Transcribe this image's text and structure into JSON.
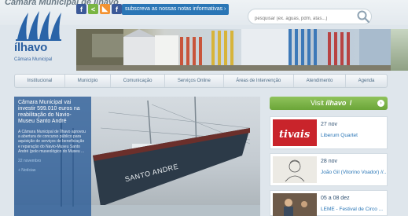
{
  "header": {
    "partial_title": "Câmara Municipal de Ílhavo",
    "social_icons": [
      {
        "name": "facebook-icon",
        "glyph": "f",
        "color": "#3b5998"
      },
      {
        "name": "share-icon",
        "glyph": "<",
        "color": "#79b543"
      },
      {
        "name": "rss-icon",
        "glyph": "◣",
        "color": "#f39332"
      },
      {
        "name": "facebook-alt-icon",
        "glyph": "f",
        "color": "#3b5998"
      }
    ],
    "subscribe_label": "subscreva as nossas notas informativas ›",
    "search_placeholder": "pesquisar (ex. águas, pdm, atas...)"
  },
  "logo": {
    "name": "ílhavo",
    "subtitle": "Câmara Municipal"
  },
  "nav": {
    "items": [
      "Institucional",
      "Município",
      "Comunicação",
      "Serviços Online",
      "Áreas de Intervenção",
      "Atendimento",
      "Agenda"
    ]
  },
  "feature": {
    "title": "Câmara Municipal vai investir 599.010 euros na reabilitação do Navio-Museu Santo André",
    "body": "A Câmara Municipal de Ílhavo aprovou a abertura de concurso público para aquisição de serviços de beneficiação e reparação do Navio-Museu Santo André (polo museológico do Museu ...",
    "date": "22 novembro",
    "more": "+ Notícias",
    "ship_name": "SANTO ANDRE"
  },
  "sidebar": {
    "visit_label": "Visit",
    "visit_brand": "ílhavo",
    "events": [
      {
        "date": "27 nov",
        "title": "Liberum Quartet",
        "thumb_text": "tivais"
      },
      {
        "date": "28 nov",
        "title": "João Gil (Vitorino Voador) //...",
        "thumb_text": ""
      },
      {
        "date": "05 a 08 dez",
        "title": "LEME - Festival de Circo ...",
        "thumb_text": ""
      }
    ]
  }
}
